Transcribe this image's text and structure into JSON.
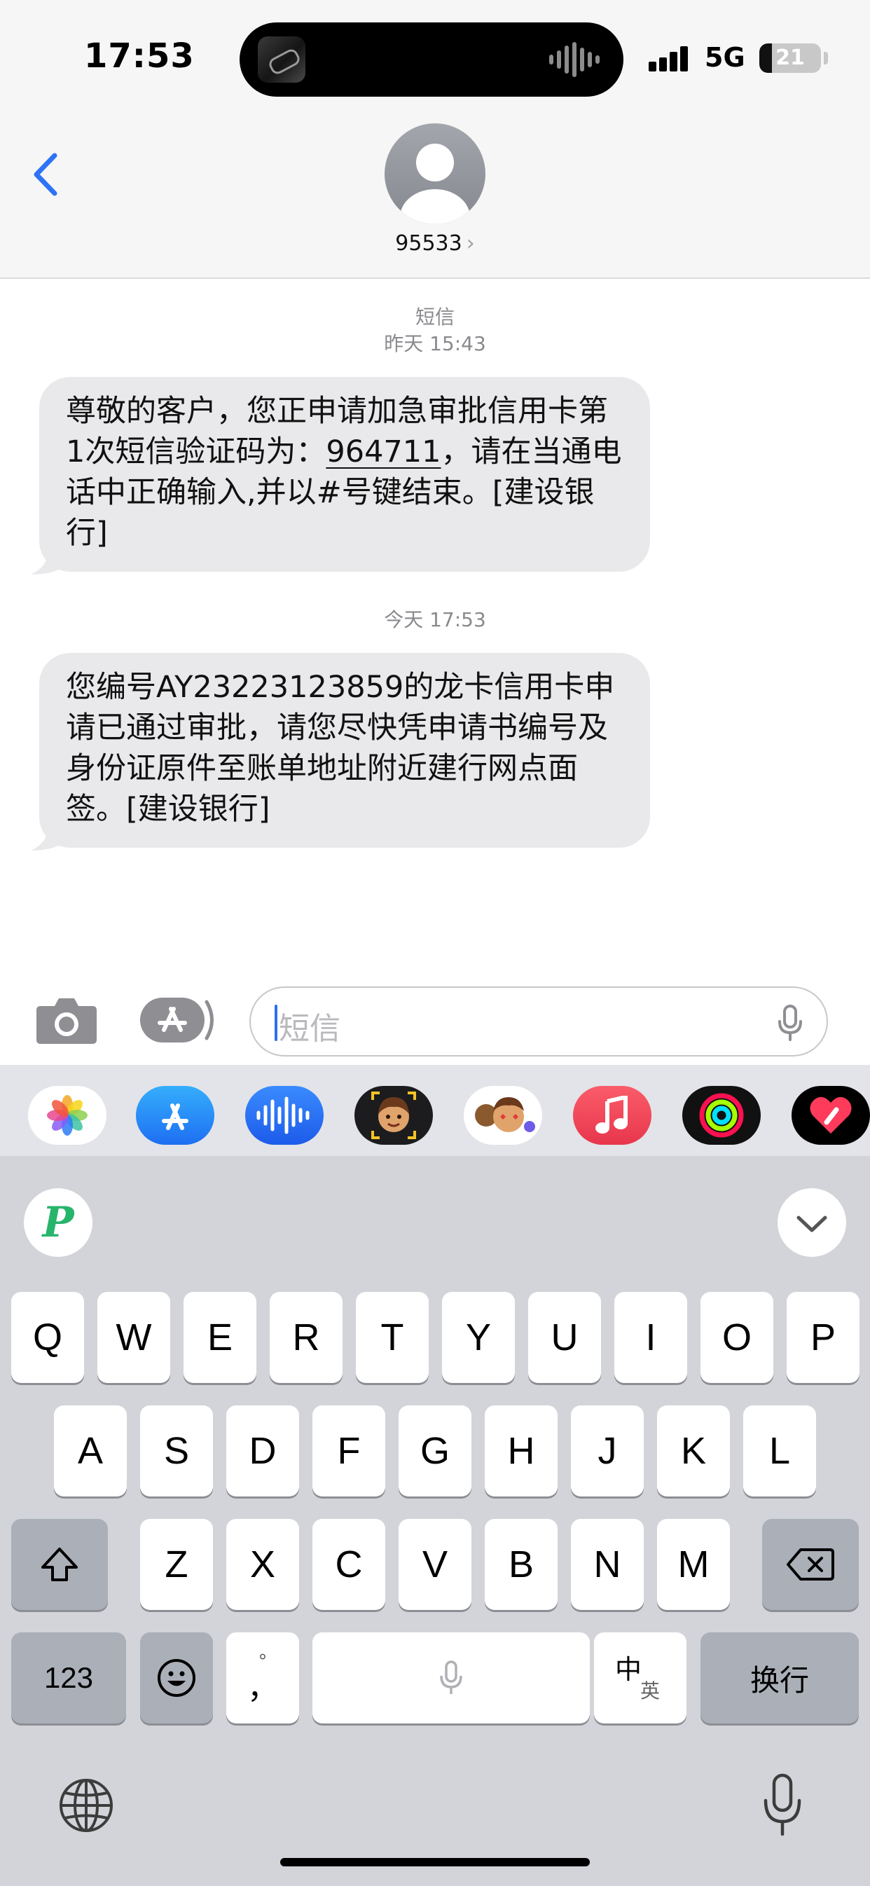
{
  "status_bar": {
    "time": "17:53",
    "network": "5G",
    "battery": "21",
    "battery_level": 0.21
  },
  "header": {
    "contact": "95533"
  },
  "messages": [
    {
      "sender_type": "短信",
      "timestamp": "昨天 15:43",
      "text_before": "尊敬的客户，您正申请加急审批信用卡第1次短信验证码为：",
      "code": "964711",
      "text_after": "，请在当通电话中正确输入,并以#号键结束。[建设银行]"
    },
    {
      "timestamp": "今天 17:53",
      "text": "您编号AY23223123859的龙卡信用卡申请已通过审批，请您尽快凭申请书编号及身份证原件至账单地址附近建行网点面签。[建设银行]"
    }
  ],
  "input": {
    "placeholder": "短信"
  },
  "app_strip": [
    "photos-icon",
    "app-store-icon",
    "audio-message-icon",
    "memoji-icon",
    "animoji-stickers-icon",
    "music-icon",
    "activity-icon",
    "digital-touch-icon"
  ],
  "keyboard": {
    "logo": "P",
    "row1": [
      "Q",
      "W",
      "E",
      "R",
      "T",
      "Y",
      "U",
      "I",
      "O",
      "P"
    ],
    "row2": [
      "A",
      "S",
      "D",
      "F",
      "G",
      "H",
      "J",
      "K",
      "L"
    ],
    "row3": [
      "Z",
      "X",
      "C",
      "V",
      "B",
      "N",
      "M"
    ],
    "numbers_label": "123",
    "punct_top": "°",
    "punct_bottom": "，",
    "lang_top": "中",
    "lang_bottom": "英",
    "return_label": "换行"
  }
}
